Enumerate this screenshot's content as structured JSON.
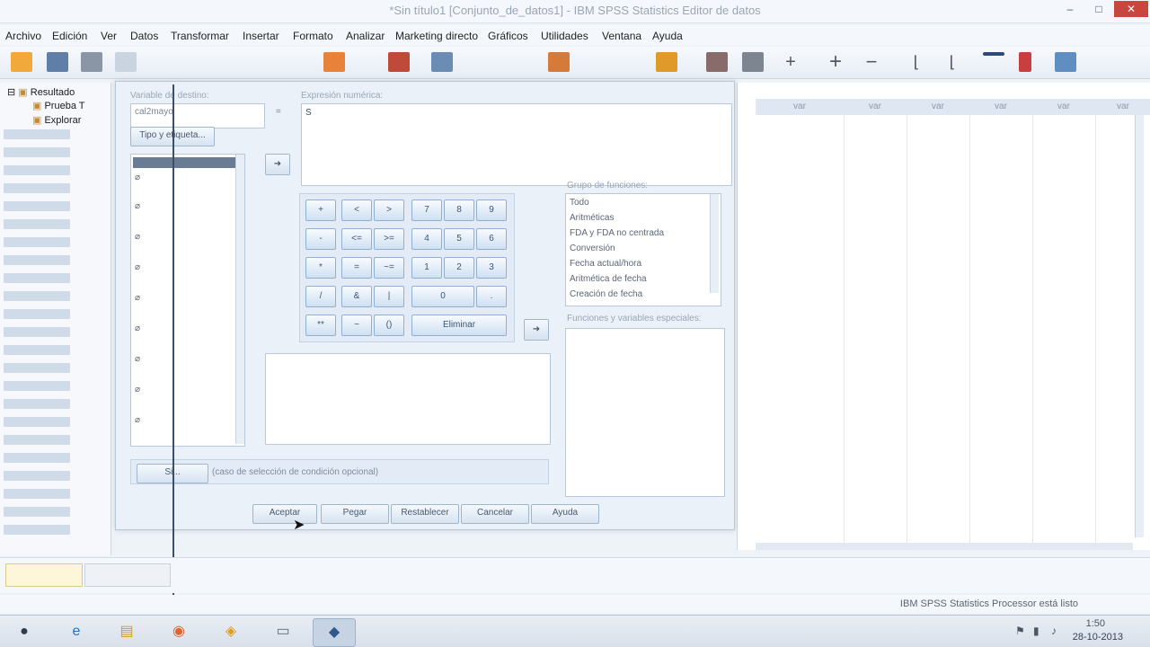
{
  "window": {
    "title": "*Sin título1 [Conjunto_de_datos1] - IBM SPSS Statistics Editor de datos",
    "minimize": "–",
    "maximize": "□",
    "close": "✕"
  },
  "menu": [
    "Archivo",
    "Edición",
    "Ver",
    "Datos",
    "Transformar",
    "Insertar",
    "Formato",
    "Analizar",
    "Marketing directo",
    "Gráficos",
    "Utilidades",
    "Ventana",
    "Ayuda"
  ],
  "outline": {
    "root": "Resultado",
    "children": [
      "Prueba T",
      "Explorar"
    ]
  },
  "dialog": {
    "target_var_label": "Variable de destino:",
    "target_var_value": "cal2mayo",
    "type_label_button": "Tipo y etiqueta...",
    "numeric_expr_label": "Expresión numérica:",
    "numeric_expr_value": "S",
    "arrow_symbol": "➜",
    "keys": [
      "+",
      "<",
      ">",
      "7",
      "8",
      "9",
      "-",
      "<=",
      ">=",
      "4",
      "5",
      "6",
      "*",
      "=",
      "~=",
      "1",
      "2",
      "3",
      "/",
      "&",
      "|",
      "0",
      ".",
      "**",
      "~",
      "()",
      "Eliminar"
    ],
    "function_group_label": "Grupo de funciones:",
    "function_groups": [
      "Todo",
      "Aritméticas",
      "FDA y FDA no centrada",
      "Conversión",
      "Fecha actual/hora",
      "Aritmética de fecha",
      "Creación de fecha"
    ],
    "functions_vars_label": "Funciones y variables especiales:",
    "if_button": "Si...",
    "if_text": "(caso de selección de condición opcional)",
    "buttons": [
      "Aceptar",
      "Pegar",
      "Restablecer",
      "Cancelar",
      "Ayuda"
    ]
  },
  "grid": {
    "headers": [
      "var",
      "var",
      "var",
      "var",
      "var",
      "var"
    ]
  },
  "status": {
    "text": "IBM SPSS Statistics Processor está listo"
  },
  "taskbar": {
    "time": "1:50",
    "date": "28-10-2013"
  },
  "colors": {
    "accent": "#9fb6cf",
    "close_button": "#c7463e",
    "key_border": "#8fb0d3"
  }
}
